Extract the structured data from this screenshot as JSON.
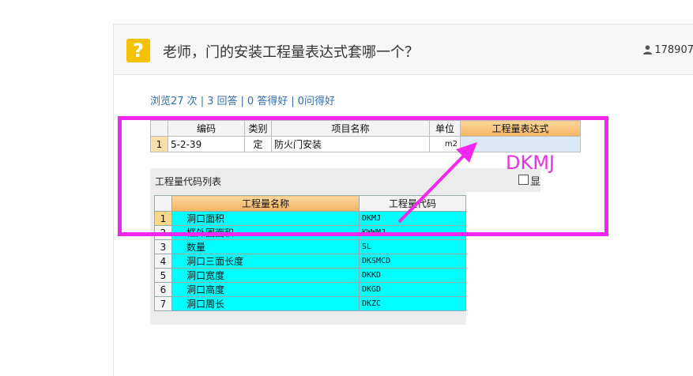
{
  "question": {
    "title": "老师，门的安装工程量表达式套哪一个？",
    "user_id": "178907"
  },
  "stats": {
    "views": "浏览27 次",
    "answers": "3 回答",
    "good_answers": "0 答得好",
    "good_questions": "0问得好"
  },
  "top_table": {
    "headers": [
      "编码",
      "类别",
      "项目名称",
      "单位",
      "工程量表达式"
    ],
    "row": {
      "num": "1",
      "code": "5-2-39",
      "type": "定",
      "name": "防火门安装",
      "unit": "m2",
      "expr": ""
    }
  },
  "code_list": {
    "title": "工程量代码列表",
    "checkbox_label": "显",
    "headers": [
      "工程量名称",
      "工程量代码"
    ],
    "rows": [
      {
        "num": "1",
        "name": "洞口面积",
        "code": "DKMJ"
      },
      {
        "num": "2",
        "name": "框外围面积",
        "code": "KWWMJ"
      },
      {
        "num": "3",
        "name": "数量",
        "code": "SL"
      },
      {
        "num": "4",
        "name": "洞口三面长度",
        "code": "DKSMCD"
      },
      {
        "num": "5",
        "name": "洞口宽度",
        "code": "DKKD"
      },
      {
        "num": "6",
        "name": "洞口高度",
        "code": "DKGD"
      },
      {
        "num": "7",
        "name": "洞口周长",
        "code": "DKZC"
      }
    ]
  },
  "annotation": {
    "text": "DKMJ",
    "color": "#e234e2"
  },
  "colors": {
    "accent": "#f5c200",
    "highlight": "#00ffff",
    "frame": "#f126f1",
    "link": "#2f6fb3"
  }
}
